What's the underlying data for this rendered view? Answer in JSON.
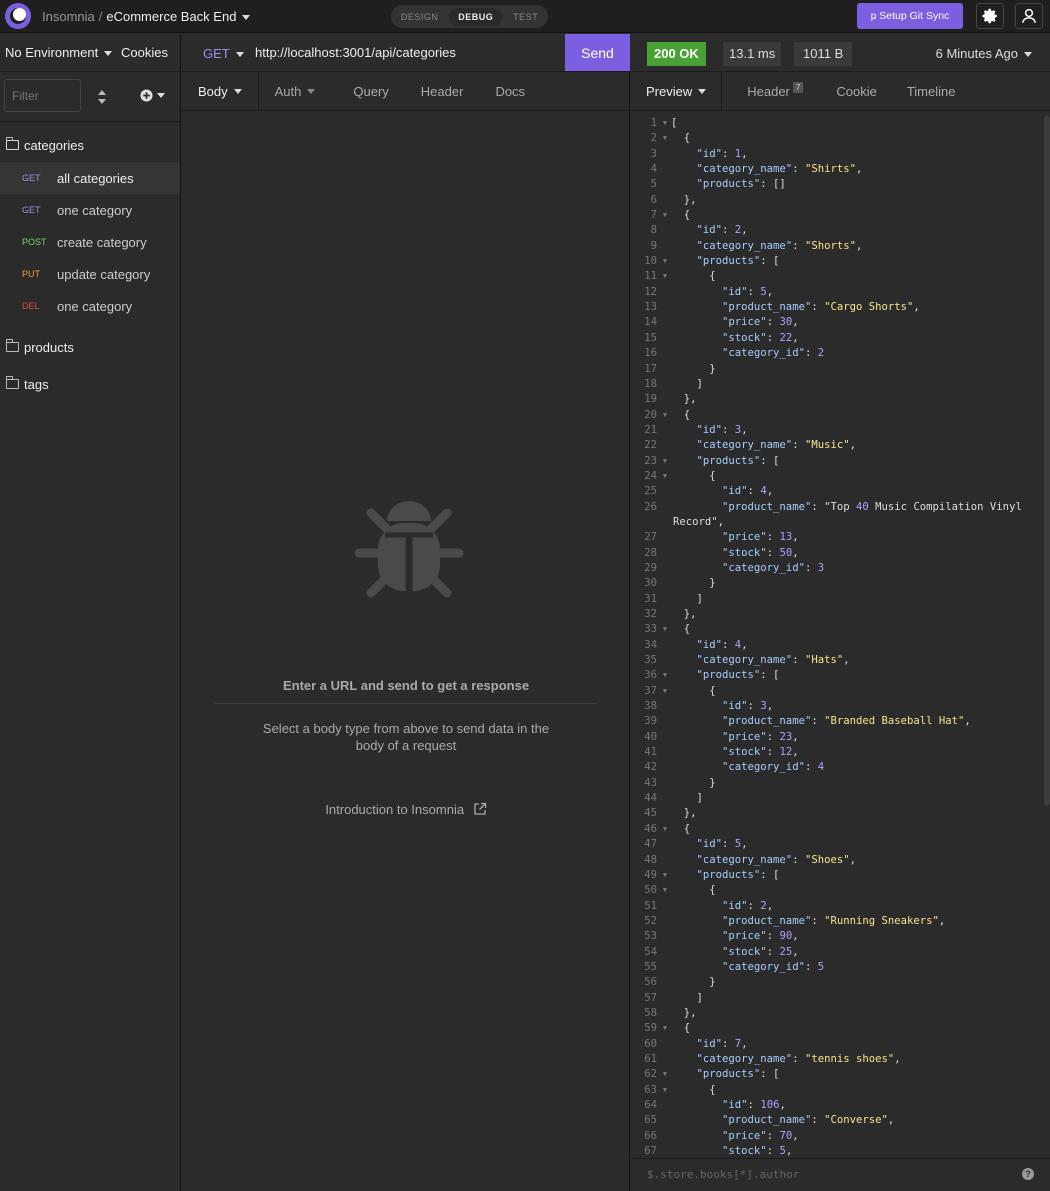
{
  "topbar": {
    "app_name": "Insomnia",
    "separator": "/",
    "workspace": "eCommerce Back End",
    "modes": [
      "DESIGN",
      "DEBUG",
      "TEST"
    ],
    "active_mode": "DEBUG",
    "git_sync_label": "Setup Git Sync"
  },
  "sidebar": {
    "environment": "No Environment",
    "cookies": "Cookies",
    "filter_placeholder": "Filter",
    "folders": [
      {
        "name": "categories",
        "open": true
      },
      {
        "name": "products",
        "open": false
      },
      {
        "name": "tags",
        "open": false
      }
    ],
    "requests": [
      {
        "method": "GET",
        "name": "all categories",
        "active": true
      },
      {
        "method": "GET",
        "name": "one category",
        "active": false
      },
      {
        "method": "POST",
        "name": "create category",
        "active": false
      },
      {
        "method": "PUT",
        "name": "update category",
        "active": false
      },
      {
        "method": "DEL",
        "name": "one category",
        "active": false
      }
    ]
  },
  "request": {
    "method": "GET",
    "url": "http://localhost:3001/api/categories",
    "send_label": "Send",
    "tabs": [
      "Body",
      "Auth",
      "Query",
      "Header",
      "Docs"
    ],
    "empty_title": "Enter a URL and send to get a response",
    "empty_body": "Select a body type from above to send data in the body of a request",
    "intro_link": "Introduction to Insomnia"
  },
  "response": {
    "status": "200 OK",
    "time": "13.1 ms",
    "size": "1011 B",
    "age": "6 Minutes Ago",
    "tabs": [
      "Preview",
      "Header",
      "Cookie",
      "Timeline"
    ],
    "header_count": "7",
    "filter_placeholder": "$.store.books[*].author",
    "help": "?",
    "lines": [
      "[",
      "  {",
      "    \"id\": 1,",
      "    \"category_name\": \"Shirts\",",
      "    \"products\": []",
      "  },",
      "  {",
      "    \"id\": 2,",
      "    \"category_name\": \"Shorts\",",
      "    \"products\": [",
      "      {",
      "        \"id\": 5,",
      "        \"product_name\": \"Cargo Shorts\",",
      "        \"price\": 30,",
      "        \"stock\": 22,",
      "        \"category_id\": 2",
      "      }",
      "    ]",
      "  },",
      "  {",
      "    \"id\": 3,",
      "    \"category_name\": \"Music\",",
      "    \"products\": [",
      "      {",
      "        \"id\": 4,",
      "        \"product_name\": \"Top 40 Music Compilation Vinyl",
      "Record\",",
      "        \"price\": 13,",
      "        \"stock\": 50,",
      "        \"category_id\": 3",
      "      }",
      "    ]",
      "  },",
      "  {",
      "    \"id\": 4,",
      "    \"category_name\": \"Hats\",",
      "    \"products\": [",
      "      {",
      "        \"id\": 3,",
      "        \"product_name\": \"Branded Baseball Hat\",",
      "        \"price\": 23,",
      "        \"stock\": 12,",
      "        \"category_id\": 4",
      "      }",
      "    ]",
      "  },",
      "  {",
      "    \"id\": 5,",
      "    \"category_name\": \"Shoes\",",
      "    \"products\": [",
      "      {",
      "        \"id\": 2,",
      "        \"product_name\": \"Running Sneakers\",",
      "        \"price\": 90,",
      "        \"stock\": 25,",
      "        \"category_id\": 5",
      "      }",
      "    ]",
      "  },",
      "  {",
      "    \"id\": 7,",
      "    \"category_name\": \"tennis shoes\",",
      "    \"products\": [",
      "      {",
      "        \"id\": 106,",
      "        \"product_name\": \"Converse\",",
      "        \"price\": 70,",
      "        \"stock\": 5,"
    ],
    "line_numbers": [
      "1",
      "2",
      "3",
      "4",
      "5",
      "6",
      "7",
      "8",
      "9",
      "10",
      "11",
      "12",
      "13",
      "14",
      "15",
      "16",
      "17",
      "18",
      "19",
      "20",
      "21",
      "22",
      "23",
      "24",
      "25",
      "26",
      "",
      "27",
      "28",
      "29",
      "30",
      "31",
      "32",
      "33",
      "34",
      "35",
      "36",
      "37",
      "38",
      "39",
      "40",
      "41",
      "42",
      "43",
      "44",
      "45",
      "46",
      "47",
      "48",
      "49",
      "50",
      "51",
      "52",
      "53",
      "54",
      "55",
      "56",
      "57",
      "58",
      "59",
      "60",
      "61",
      "62",
      "63",
      "64",
      "65",
      "66",
      "67"
    ],
    "fold_lines": [
      1,
      2,
      7,
      10,
      11,
      20,
      23,
      24,
      33,
      36,
      37,
      46,
      49,
      50,
      59,
      62,
      63
    ]
  },
  "colors": {
    "accent": "#7b5fe0",
    "status_ok": "#49a135",
    "get": "#a58ce8",
    "post": "#73d36a",
    "put": "#f59b36",
    "del": "#e84848"
  }
}
